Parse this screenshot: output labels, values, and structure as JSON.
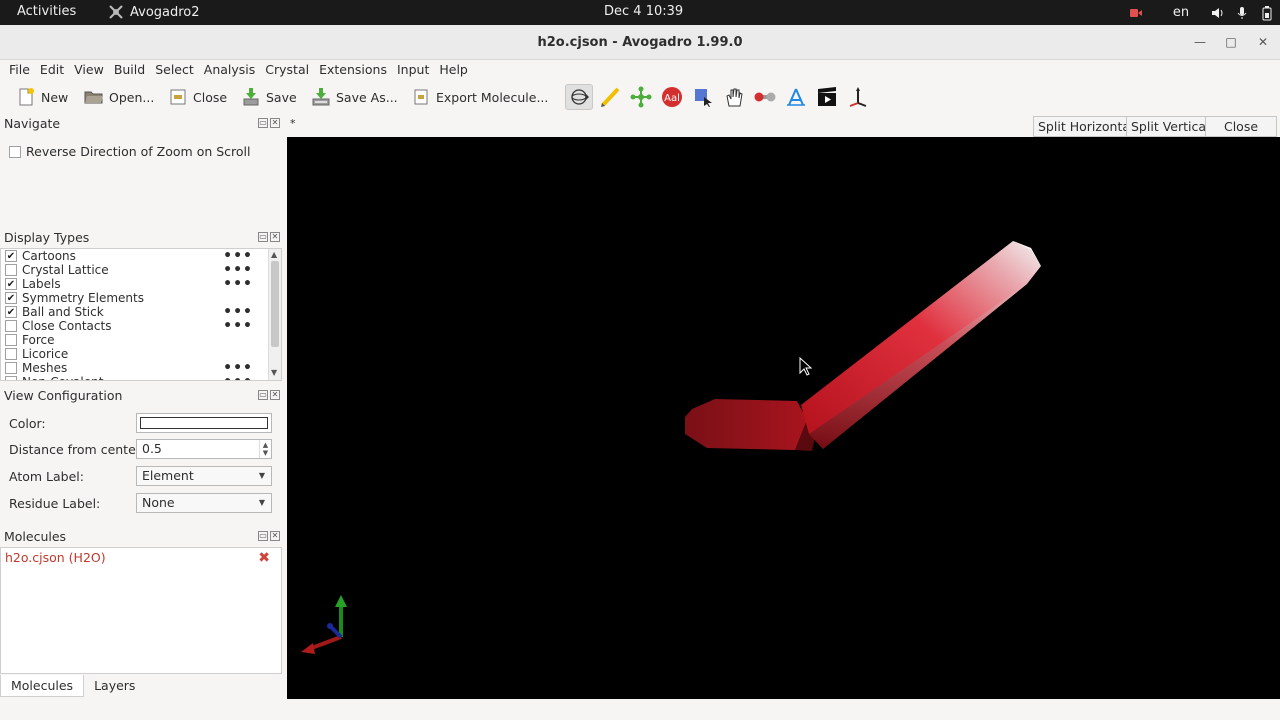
{
  "system_bar": {
    "activities": "Activities",
    "app_name": "Avogadro2",
    "clock": "Dec 4  10:39",
    "language": "en"
  },
  "window": {
    "title": "h2o.cjson - Avogadro 1.99.0"
  },
  "menu": [
    "File",
    "Edit",
    "View",
    "Build",
    "Select",
    "Analysis",
    "Crystal",
    "Extensions",
    "Input",
    "Help"
  ],
  "toolbar": {
    "new": "New",
    "open": "Open...",
    "close": "Close",
    "save": "Save",
    "save_as": "Save As...",
    "export": "Export Molecule..."
  },
  "tools": [
    "navigate-icon",
    "draw-icon",
    "template-icon",
    "label-icon",
    "select-icon",
    "manipulate-icon",
    "bond-centric-icon",
    "measure-icon",
    "animation-icon",
    "align-icon"
  ],
  "navigate": {
    "header": "Navigate",
    "reverse_zoom": "Reverse Direction of Zoom on Scroll",
    "reverse_zoom_checked": false
  },
  "display_types": {
    "header": "Display Types",
    "items": [
      {
        "label": "Cartoons",
        "checked": true,
        "has_settings": true
      },
      {
        "label": "Crystal Lattice",
        "checked": false,
        "has_settings": true
      },
      {
        "label": "Labels",
        "checked": true,
        "has_settings": true
      },
      {
        "label": "Symmetry Elements",
        "checked": true,
        "has_settings": false
      },
      {
        "label": "Ball and Stick",
        "checked": true,
        "has_settings": true
      },
      {
        "label": "Close Contacts",
        "checked": false,
        "has_settings": true
      },
      {
        "label": "Force",
        "checked": false,
        "has_settings": false
      },
      {
        "label": "Licorice",
        "checked": false,
        "has_settings": false
      },
      {
        "label": "Meshes",
        "checked": false,
        "has_settings": true
      },
      {
        "label": "Non-Covalent",
        "checked": false,
        "has_settings": true
      }
    ]
  },
  "view_config": {
    "header": "View Configuration",
    "color_label": "Color:",
    "distance_label": "Distance from center:",
    "distance_value": "0.5",
    "atom_label_label": "Atom Label:",
    "atom_label_value": "Element",
    "residue_label_label": "Residue Label:",
    "residue_label_value": "None"
  },
  "molecules": {
    "header": "Molecules",
    "items": [
      "h2o.cjson (H2O)"
    ]
  },
  "bottom_tabs": [
    "Molecules",
    "Layers"
  ],
  "viewport_tabs": {
    "modified_marker": "*",
    "split_horizontal": "Split Horizontal",
    "split_vertical": "Split Vertical",
    "close": "Close"
  }
}
